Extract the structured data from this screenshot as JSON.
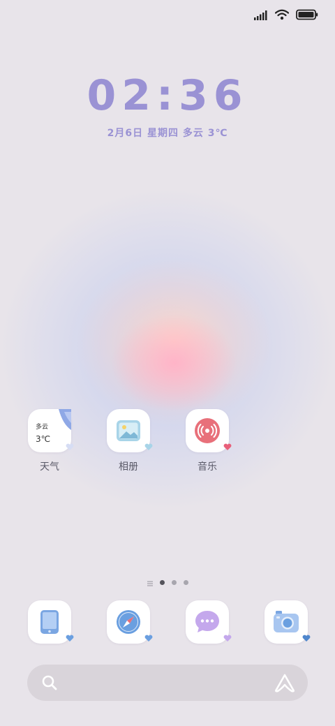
{
  "status_bar": {
    "signal_icon": "signal-bars-icon",
    "wifi_icon": "wifi-icon",
    "battery_icon": "battery-icon",
    "battery_level": 1.0
  },
  "lock": {
    "time": "02:36",
    "date": "2月6日  星期四  多云  3℃"
  },
  "apps": [
    {
      "label": "天气",
      "icon": "weather-widget-icon",
      "weather": {
        "condition": "多云",
        "temp": "3℃"
      }
    },
    {
      "label": "相册",
      "icon": "gallery-icon"
    },
    {
      "label": "音乐",
      "icon": "music-icon"
    }
  ],
  "page_indicator": {
    "pages": 3,
    "active": 1
  },
  "dock": [
    {
      "icon": "phone-device-icon"
    },
    {
      "icon": "compass-icon"
    },
    {
      "icon": "message-icon"
    },
    {
      "icon": "camera-icon"
    }
  ],
  "search_bar": {
    "search_icon": "search-icon",
    "assistant_icon": "assistant-logo-icon"
  },
  "colors": {
    "accent": "#9a92d4",
    "heart_blue": "#6b9fe0",
    "heart_pink": "#f07a98",
    "heart_purple": "#c4a8ec"
  }
}
